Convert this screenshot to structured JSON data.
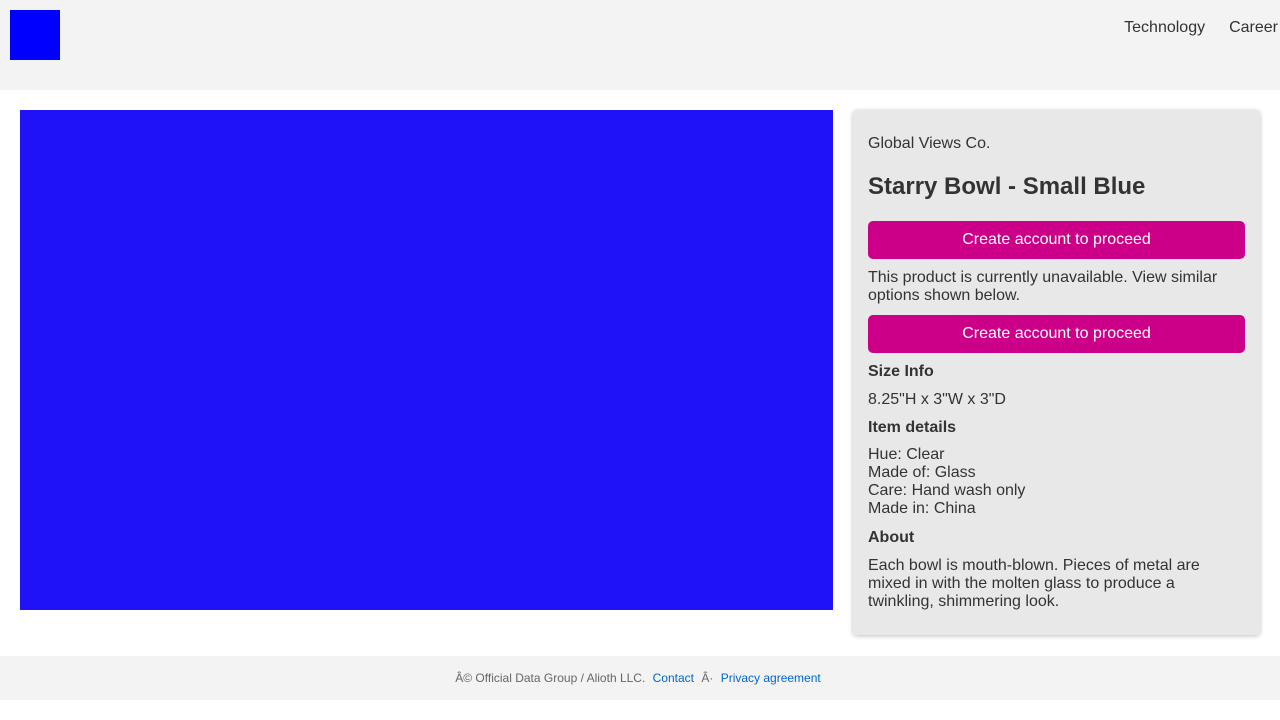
{
  "header": {
    "logo_color": "#0000ff",
    "nav": [
      "Technology",
      "Career"
    ]
  },
  "product": {
    "image_color": "#1f12f7",
    "brand": "Global Views Co.",
    "title": "Starry Bowl - Small Blue",
    "cta_label": "Create account to proceed",
    "cta_color": "#cc0088",
    "unavailable_text": "This product is currently unavailable. View similar options shown below.",
    "size_heading": "Size Info",
    "size_value": "8.25\"H x 3\"W x 3\"D",
    "details_heading": "Item details",
    "details": [
      "Hue: Clear",
      "Made of: Glass",
      "Care: Hand wash only",
      "Made in: China"
    ],
    "about_heading": "About",
    "about_text": "Each bowl is mouth-blown. Pieces of metal are mixed in with the molten glass to produce a twinkling, shimmering look."
  },
  "footer": {
    "copyright": "Â© Official Data Group / Alioth LLC.",
    "contact_label": "Contact",
    "separator": "Â·",
    "privacy_label": "Privacy agreement"
  }
}
